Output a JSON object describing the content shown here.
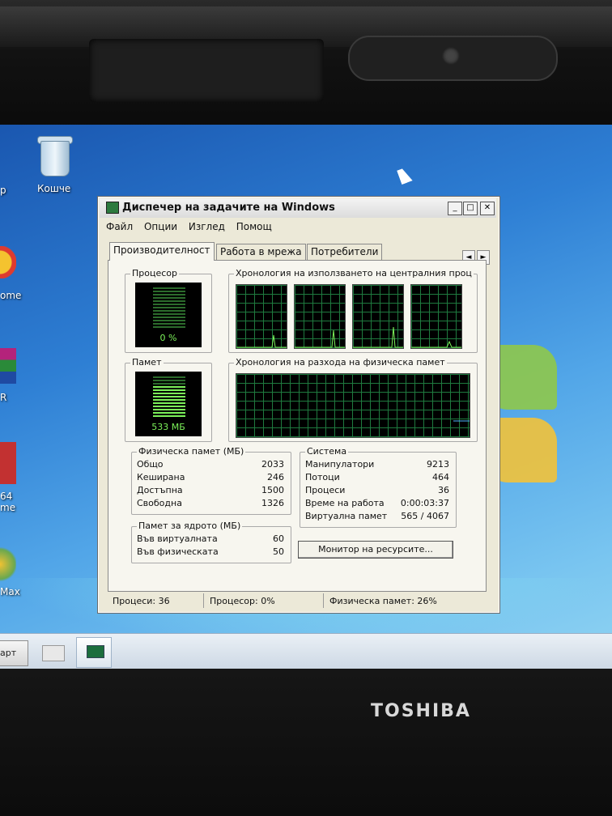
{
  "desktop": {
    "recycle_bin_label": "Кошче",
    "side_labels": [
      "р",
      "ome",
      "R",
      "64",
      "me",
      "Max"
    ]
  },
  "window": {
    "title": "Диспечер на задачите на Windows",
    "controls": {
      "minimize": "_",
      "maximize": "□",
      "close": "✕"
    },
    "menu": [
      "Файл",
      "Опции",
      "Изглед",
      "Помощ"
    ],
    "tabs": [
      "Производителност",
      "Работа в мрежа",
      "Потребители"
    ],
    "tab_arrows": [
      "◄",
      "►"
    ]
  },
  "performance": {
    "cpu": {
      "label": "Процесор",
      "value": "0 %",
      "usage_percent": 0
    },
    "cpu_history": {
      "label": "Хронология на използването на централния проц"
    },
    "memory": {
      "label": "Памет",
      "value": "533 МБ",
      "usage_percent": 26
    },
    "memory_history": {
      "label": "Хронология на разхода на физическа памет"
    },
    "physical_memory": {
      "label": "Физическа памет (МБ)",
      "rows": [
        {
          "name": "Общо",
          "value": "2033"
        },
        {
          "name": "Кеширана",
          "value": "246"
        },
        {
          "name": "Достъпна",
          "value": "1500"
        },
        {
          "name": "Свободна",
          "value": "1326"
        }
      ]
    },
    "kernel_memory": {
      "label": "Памет за ядрото (МБ)",
      "rows": [
        {
          "name": "Във виртуалната",
          "value": "60"
        },
        {
          "name": "Във физическата",
          "value": "50"
        }
      ]
    },
    "system": {
      "label": "Система",
      "rows": [
        {
          "name": "Манипулатори",
          "value": "9213"
        },
        {
          "name": "Потоци",
          "value": "464"
        },
        {
          "name": "Процеси",
          "value": "36"
        },
        {
          "name": "Време на работа",
          "value": "0:00:03:37"
        },
        {
          "name": "Виртуална памет",
          "value": "565 / 4067"
        }
      ]
    },
    "resource_monitor_button": "Монитор на ресурсите..."
  },
  "statusbar": {
    "processes": "Процеси: 36",
    "cpu": "Процесор: 0%",
    "memory": "Физическа памет: 26%"
  },
  "taskbar": {
    "start_label": "арт"
  },
  "brand": "TOSHIBA"
}
